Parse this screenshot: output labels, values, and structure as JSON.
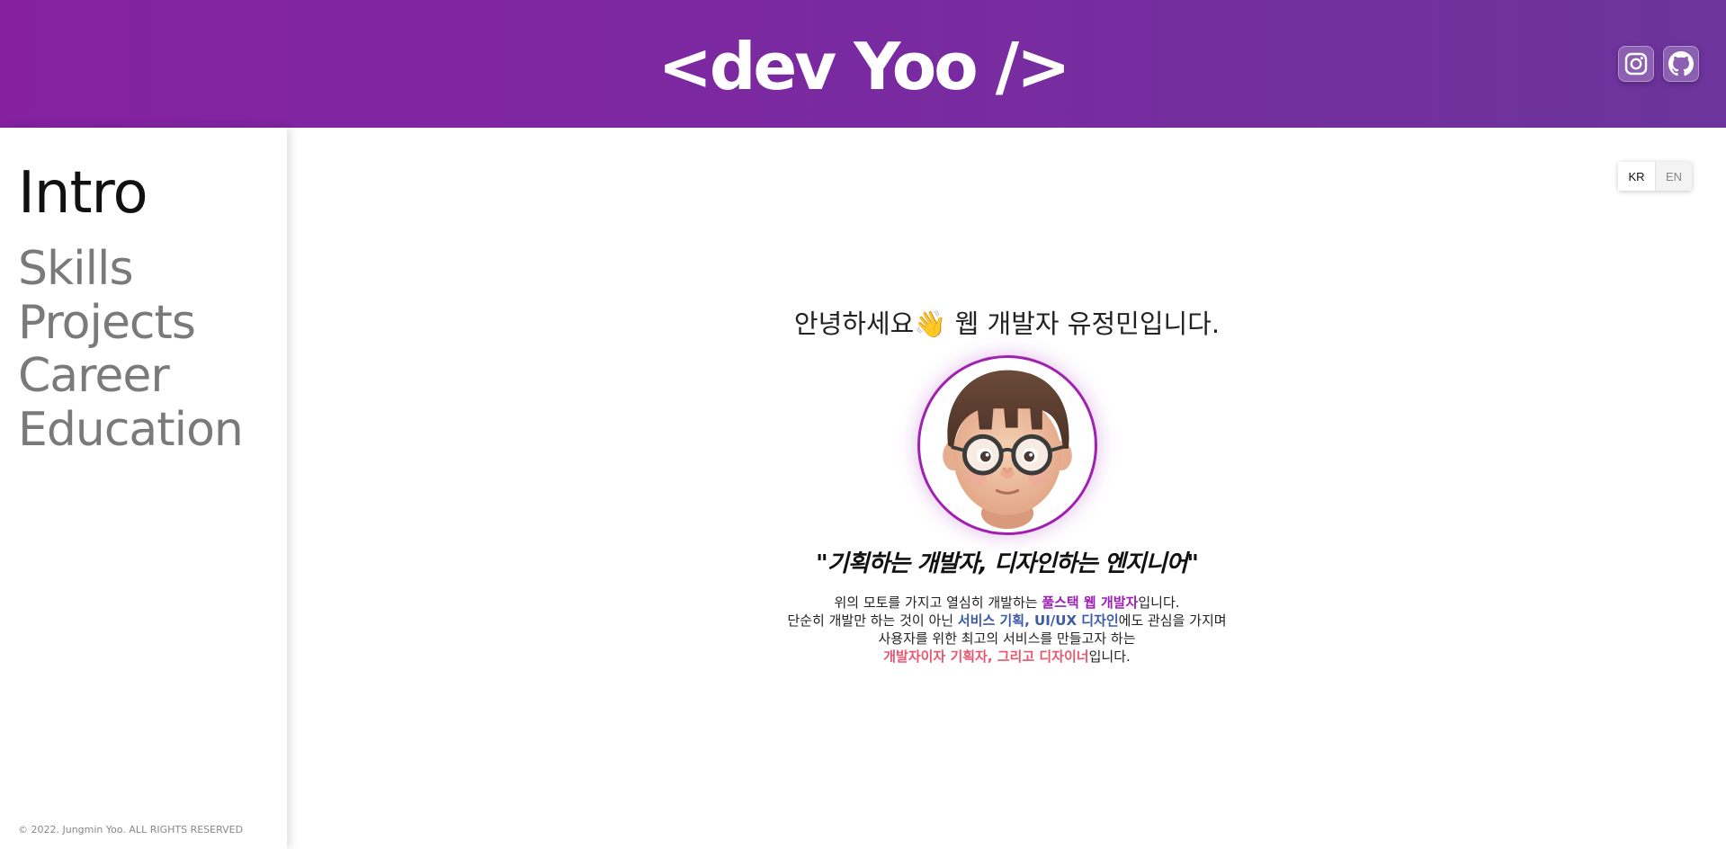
{
  "header": {
    "logo": "<dev Yoo />",
    "social": [
      {
        "name": "instagram-icon"
      },
      {
        "name": "github-icon"
      }
    ]
  },
  "sidebar": {
    "items": [
      {
        "label": "Intro",
        "active": true
      },
      {
        "label": "Skills",
        "active": false
      },
      {
        "label": "Projects",
        "active": false
      },
      {
        "label": "Career",
        "active": false
      },
      {
        "label": "Education",
        "active": false
      }
    ],
    "copyright": "© 2022. Jungmin Yoo. ALL RIGHTS RESERVED"
  },
  "lang": {
    "kr": "KR",
    "en": "EN",
    "selected": "KR"
  },
  "intro": {
    "greeting": "안녕하세요👋 웹 개발자 유정민입니다.",
    "motto": "\"기획하는 개발자, 디자인하는 엔지니어\"",
    "line1_pre": "위의 모토를 가지고 열심히 개발하는 ",
    "line1_hl": "풀스택 웹 개발자",
    "line1_post": "입니다.",
    "line2_pre": "단순히 개발만 하는 것이 아닌 ",
    "line2_hl1": "서비스 기획",
    "line2_sep": ", ",
    "line2_hl2": "UI/UX 디자인",
    "line2_post": "에도 관심을 가지며",
    "line3": "사용자를 위한 최고의 서비스를 만들고자 하는",
    "line4_hl": "개발자이자 기획자, 그리고 디자이너",
    "line4_post": "입니다."
  },
  "colors": {
    "header_start": "#85219f",
    "header_end": "#6c349c",
    "accent_purple": "#9c1fb5",
    "accent_blue": "#3d5aa8",
    "accent_pink": "#e8566f"
  }
}
